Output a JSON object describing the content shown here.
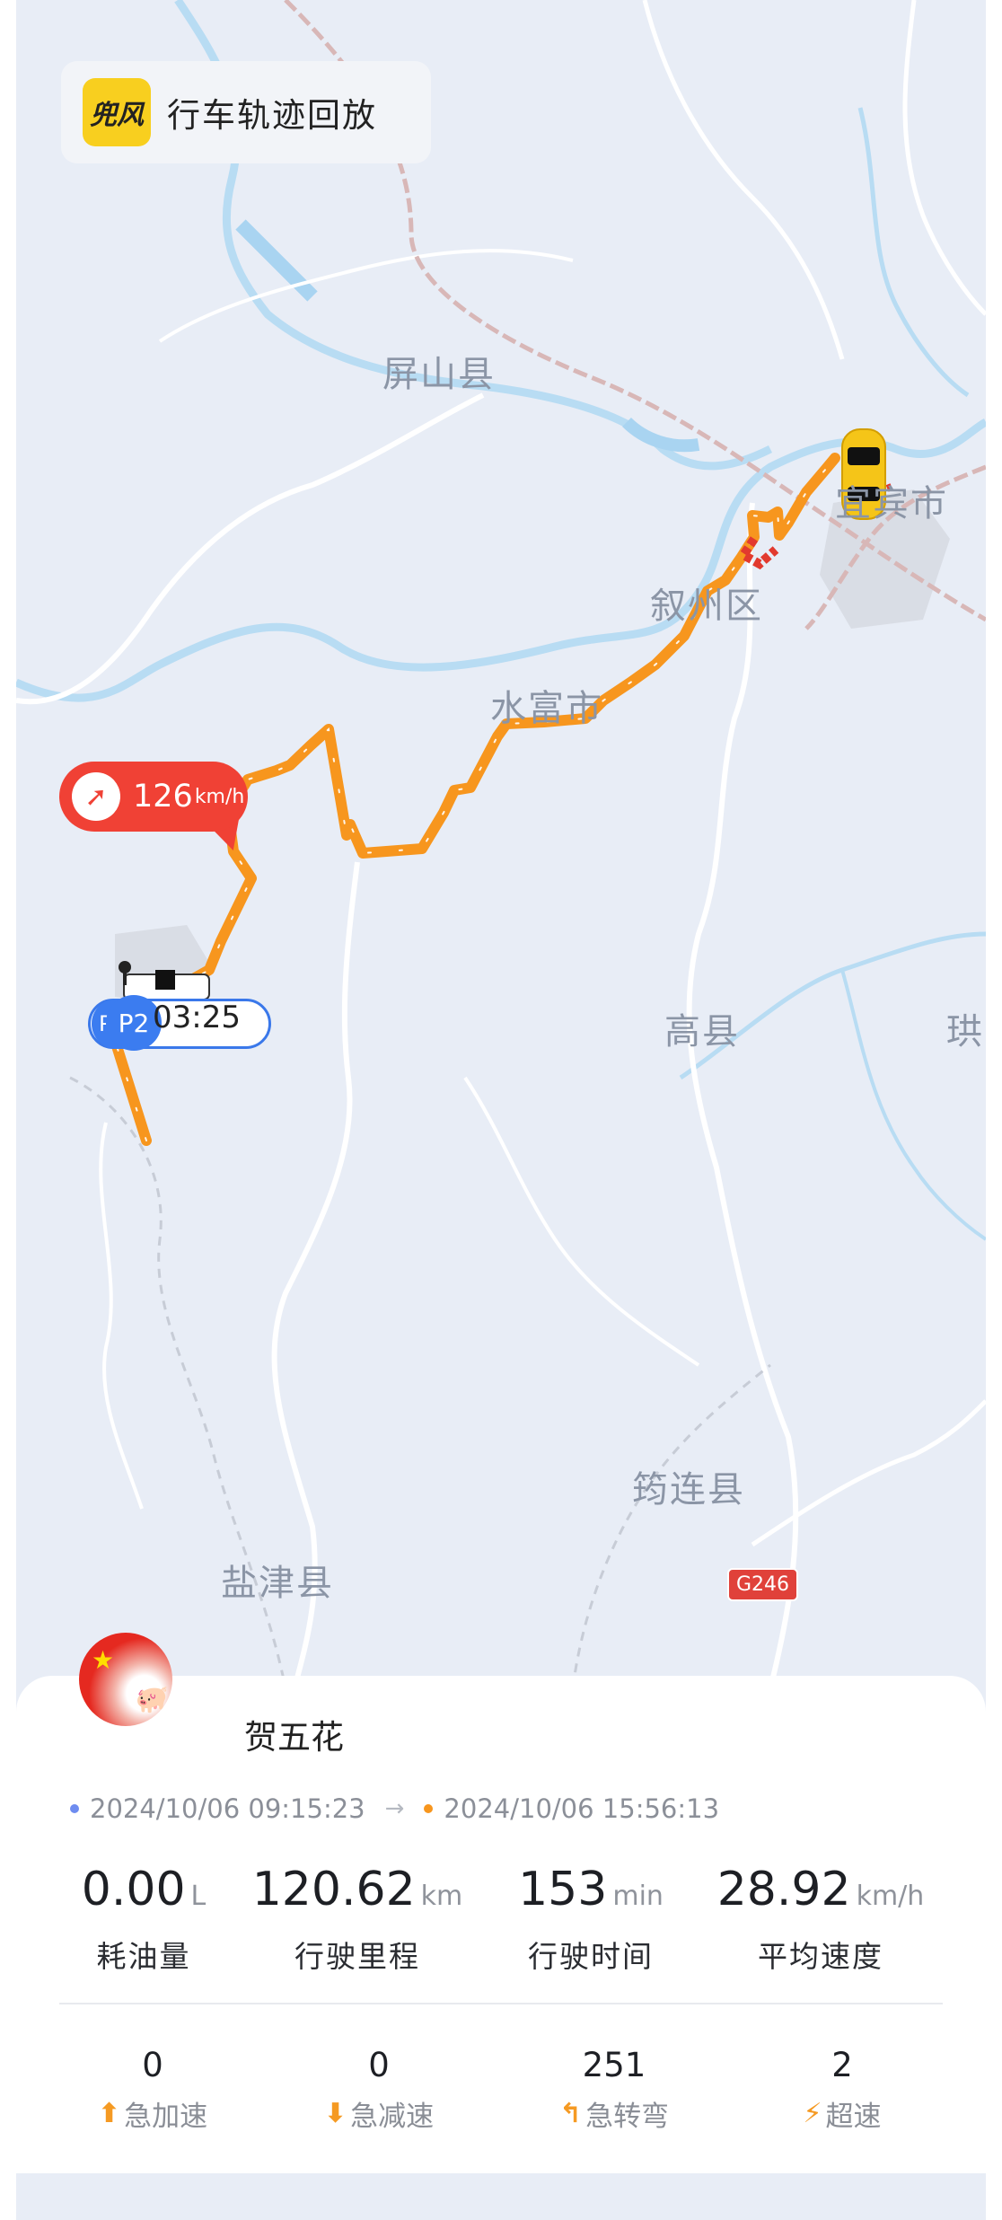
{
  "header": {
    "logo_text": "兜风",
    "title": "行车轨迹回放"
  },
  "map": {
    "labels": {
      "pingshan": "屏山县",
      "yibin": "宜宾市",
      "xuzhou": "叙州区",
      "shuifu": "水富市",
      "gaoxian": "高县",
      "gong": "珙",
      "junlian": "筠连县",
      "yanjin": "盐津县",
      "g246": "G246"
    }
  },
  "speed_marker": {
    "value": "126",
    "unit": "km/h"
  },
  "parking_marker": {
    "label": "P2",
    "prefix": "P",
    "duration": "03:25"
  },
  "user": {
    "name": "贺五花"
  },
  "trip": {
    "start": "2024/10/06 09:15:23",
    "arrow": "→",
    "end": "2024/10/06 15:56:13"
  },
  "stats": {
    "fuel": {
      "value": "0.00",
      "unit": "L",
      "label": "耗油量"
    },
    "distance": {
      "value": "120.62",
      "unit": "km",
      "label": "行驶里程"
    },
    "duration": {
      "value": "153",
      "unit": "min",
      "label": "行驶时间"
    },
    "avg_speed": {
      "value": "28.92",
      "unit": "km/h",
      "label": "平均速度"
    }
  },
  "events": {
    "accel": {
      "value": "0",
      "label": "急加速"
    },
    "brake": {
      "value": "0",
      "label": "急减速"
    },
    "turn": {
      "value": "251",
      "label": "急转弯"
    },
    "speeding": {
      "value": "2",
      "label": "超速"
    }
  },
  "colors": {
    "route": "#f7961e",
    "accent_red": "#f04135",
    "parking_blue": "#3b7cf0",
    "start_dot": "#6e8cf0",
    "end_dot": "#f7961e"
  }
}
